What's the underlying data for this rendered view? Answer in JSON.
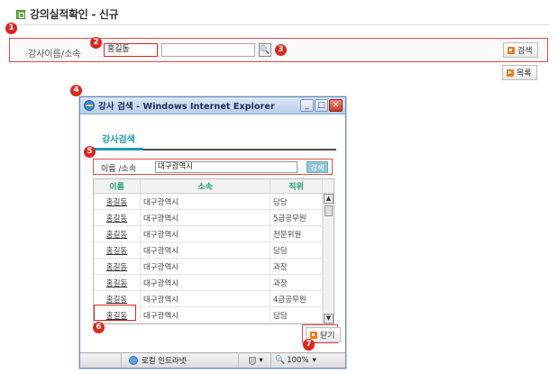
{
  "header": {
    "title": "강의실적확인 - 신규"
  },
  "markers": [
    "1",
    "2",
    "3",
    "4",
    "5",
    "6",
    "7"
  ],
  "search": {
    "label": "강사이름/소속",
    "name_value": "홍길동",
    "org_value": "",
    "search_button": "검색"
  },
  "list_button": "목록",
  "popup": {
    "window_title": "강사 검색 - Windows Internet Explorer",
    "tab": "강사검색",
    "search_label": "이름 /소속",
    "search_value": "대구광역시",
    "search_button": "검색",
    "columns": [
      "이름",
      "소속",
      "직위"
    ],
    "rows": [
      {
        "name": "홍길동",
        "org": "대구광역시",
        "position": "담당"
      },
      {
        "name": "홍길동",
        "org": "대구광역시",
        "position": "5급공무원"
      },
      {
        "name": "홍길동",
        "org": "대구광역시",
        "position": "전문위원"
      },
      {
        "name": "홍길동",
        "org": "대구광역시",
        "position": "담당"
      },
      {
        "name": "홍길동",
        "org": "대구광역시",
        "position": "과장"
      },
      {
        "name": "홍길동",
        "org": "대구광역시",
        "position": "과장"
      },
      {
        "name": "홍길동",
        "org": "대구광역시",
        "position": "4급공무원"
      },
      {
        "name": "홍길동",
        "org": "대구광역시",
        "position": "담당"
      }
    ],
    "close_button": "닫기",
    "status_zone": "로컬 인트라넷",
    "zoom": "100%"
  },
  "colors": {
    "marker": "#e0251c",
    "accent": "#1b9bb6",
    "header_text": "#169f73"
  }
}
